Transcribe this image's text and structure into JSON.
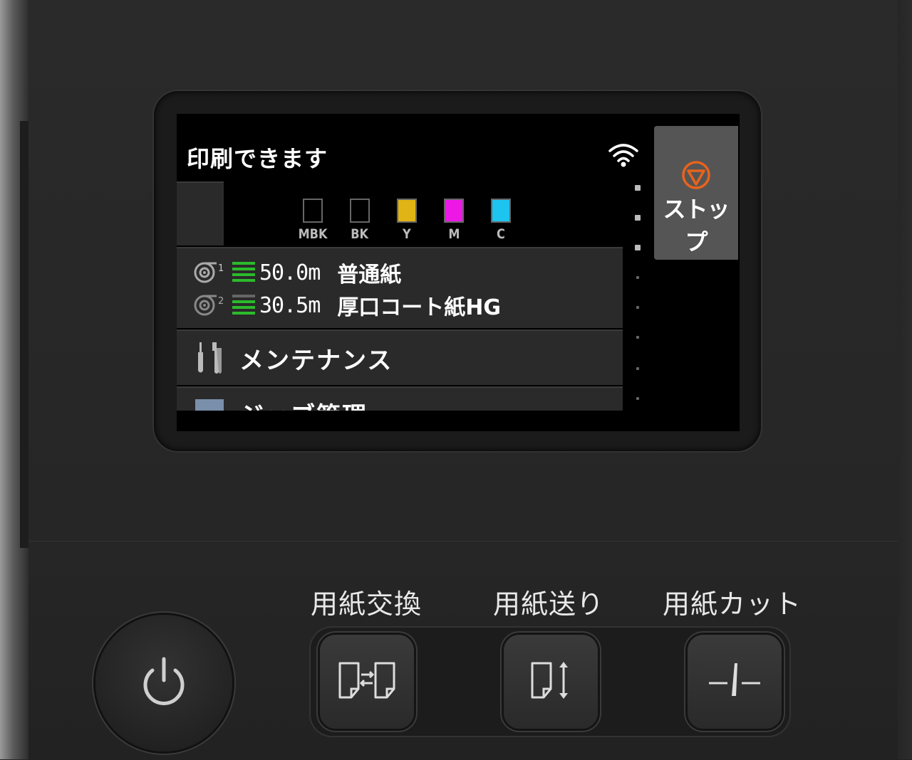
{
  "screen": {
    "status_title": "印刷できます",
    "wifi_icon": "wifi-icon",
    "ink": [
      {
        "label": "MBK",
        "color": "#000000"
      },
      {
        "label": "BK",
        "color": "#000000"
      },
      {
        "label": "Y",
        "color": "#e0b414"
      },
      {
        "label": "M",
        "color": "#ee18e6"
      },
      {
        "label": "C",
        "color": "#1ec4f0"
      }
    ],
    "paper": [
      {
        "roll": "1",
        "amount": "50.0m",
        "type": "普通紙"
      },
      {
        "roll": "2",
        "amount": "30.5m",
        "type": "厚口コート紙HG"
      }
    ],
    "menu": {
      "maintenance": "メンテナンス",
      "jobs": "ジョブ管理"
    },
    "stop_label": "ストップ",
    "accent_color": "#e8631c"
  },
  "hardware": {
    "power_icon": "power-icon",
    "buttons": [
      {
        "label": "用紙交換",
        "icon": "paper-swap-icon"
      },
      {
        "label": "用紙送り",
        "icon": "paper-feed-icon"
      },
      {
        "label": "用紙カット",
        "icon": "paper-cut-icon"
      }
    ]
  }
}
